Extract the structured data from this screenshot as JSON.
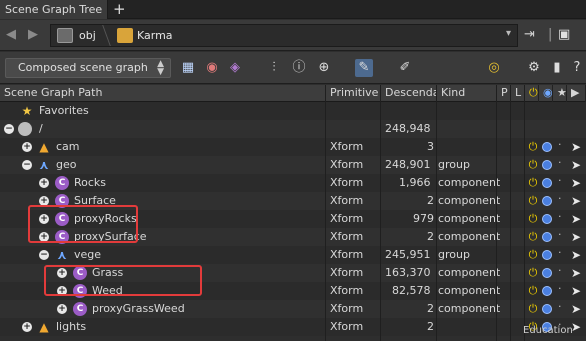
{
  "tab": {
    "title": "Scene Graph Tree",
    "add_label": "+"
  },
  "navbar": {
    "back_label": "◀",
    "forward_label": "▶",
    "path": [
      "obj",
      "Karma"
    ]
  },
  "toolbar": {
    "mode_select": "Composed scene graph"
  },
  "columns": [
    "Scene Graph Path",
    "Primitive",
    "Descenda",
    "Kind",
    "P",
    "L"
  ],
  "rows": [
    {
      "name": "Favorites",
      "primitive": "",
      "descendants": "",
      "kind": "",
      "indent": 0,
      "expander": "",
      "icon": "fav"
    },
    {
      "name": "/",
      "primitive": "",
      "descendants": "248,948",
      "kind": "",
      "indent": 0,
      "expander": "−",
      "icon": "root"
    },
    {
      "name": "cam",
      "primitive": "Xform",
      "descendants": "3",
      "kind": "",
      "indent": 1,
      "expander": "+",
      "icon": "cam"
    },
    {
      "name": "geo",
      "primitive": "Xform",
      "descendants": "248,901",
      "kind": "group",
      "indent": 1,
      "expander": "−",
      "icon": "grp"
    },
    {
      "name": "Rocks",
      "primitive": "Xform",
      "descendants": "1,966",
      "kind": "component",
      "indent": 2,
      "expander": "+",
      "icon": "comp"
    },
    {
      "name": "Surface",
      "primitive": "Xform",
      "descendants": "2",
      "kind": "component",
      "indent": 2,
      "expander": "+",
      "icon": "comp"
    },
    {
      "name": "proxyRocks",
      "primitive": "Xform",
      "descendants": "979",
      "kind": "component",
      "indent": 2,
      "expander": "+",
      "icon": "comp"
    },
    {
      "name": "proxySurface",
      "primitive": "Xform",
      "descendants": "2",
      "kind": "component",
      "indent": 2,
      "expander": "+",
      "icon": "comp"
    },
    {
      "name": "vege",
      "primitive": "Xform",
      "descendants": "245,951",
      "kind": "group",
      "indent": 2,
      "expander": "−",
      "icon": "grp"
    },
    {
      "name": "Grass",
      "primitive": "Xform",
      "descendants": "163,370",
      "kind": "component",
      "indent": 3,
      "expander": "+",
      "icon": "comp"
    },
    {
      "name": "Weed",
      "primitive": "Xform",
      "descendants": "82,578",
      "kind": "component",
      "indent": 3,
      "expander": "+",
      "icon": "comp"
    },
    {
      "name": "proxyGrassWeed",
      "primitive": "Xform",
      "descendants": "2",
      "kind": "component",
      "indent": 3,
      "expander": "+",
      "icon": "comp"
    },
    {
      "name": "lights",
      "primitive": "Xform",
      "descendants": "2",
      "kind": "",
      "indent": 1,
      "expander": "+",
      "icon": "cam"
    }
  ],
  "watermark": "Education",
  "colors": {
    "accent": "#4a7fe0",
    "highlight": "#e23b3b",
    "component": "#9b5cc6"
  }
}
